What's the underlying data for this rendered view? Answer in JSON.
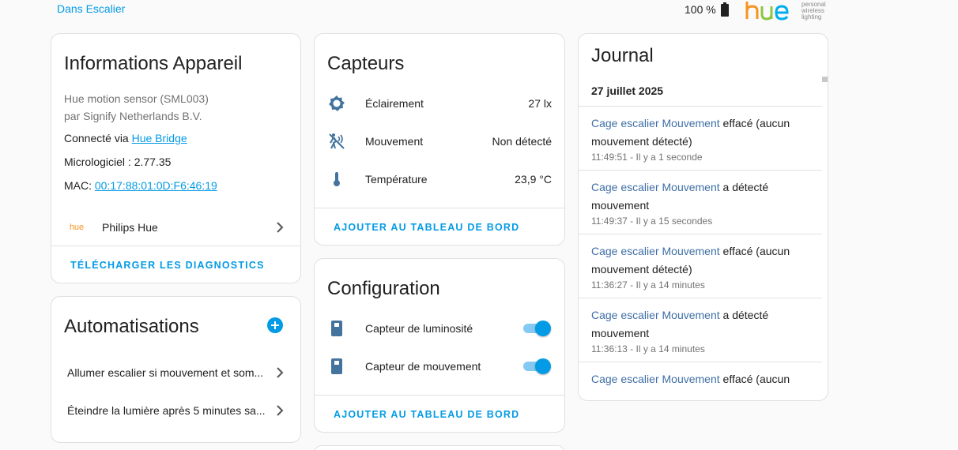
{
  "header": {
    "area_link": "Dans Escalier",
    "battery": "100 %",
    "logo": {
      "word": "hue",
      "tagline": [
        "personal",
        "wireless",
        "lighting"
      ]
    }
  },
  "device_info": {
    "title": "Informations Appareil",
    "model": "Hue motion sensor (SML003)",
    "manufacturer": "par Signify Netherlands B.V.",
    "connected_prefix": "Connecté via ",
    "connected_link": "Hue Bridge",
    "firmware": "Micrologiciel : 2.77.35",
    "mac_prefix": "MAC: ",
    "mac_value": "00:17:88:01:0D:F6:46:19",
    "integration_logo": "hue",
    "integration_name": "Philips Hue",
    "download_button": "Télécharger les diagnostics"
  },
  "automations": {
    "title": "Automatisations",
    "items": [
      {
        "label": "Allumer escalier si mouvement et som..."
      },
      {
        "label": "Éteindre la lumière après 5 minutes sa..."
      }
    ]
  },
  "sensors": {
    "title": "Capteurs",
    "items": [
      {
        "icon": "brightness-icon",
        "label": "Éclairement",
        "value": "27 lx"
      },
      {
        "icon": "motion-off-icon",
        "label": "Mouvement",
        "value": "Non détecté"
      },
      {
        "icon": "thermometer-icon",
        "label": "Température",
        "value": "23,9 °C"
      }
    ],
    "add_button": "Ajouter au tableau de bord"
  },
  "configuration": {
    "title": "Configuration",
    "items": [
      {
        "icon": "sensor-icon",
        "label": "Capteur de luminosité",
        "on": true
      },
      {
        "icon": "sensor-icon",
        "label": "Capteur de mouvement",
        "on": true
      }
    ],
    "add_button": "Ajouter au tableau de bord"
  },
  "journal": {
    "title": "Journal",
    "date": "27 juillet 2025",
    "entries": [
      {
        "entity": "Cage escalier Mouvement",
        "action": " effacé (aucun mouvement détecté)",
        "time": "11:49:51 - Il y a 1 seconde"
      },
      {
        "entity": "Cage escalier Mouvement",
        "action": " a détecté mouvement",
        "time": "11:49:37 - Il y a 15 secondes"
      },
      {
        "entity": "Cage escalier Mouvement",
        "action": " effacé (aucun mouvement détecté)",
        "time": "11:36:27 - Il y a 14 minutes"
      },
      {
        "entity": "Cage escalier Mouvement",
        "action": " a détecté mouvement",
        "time": "11:36:13 - Il y a 14 minutes"
      },
      {
        "entity": "Cage escalier Mouvement",
        "action": " effacé (aucun mouvement détecté)",
        "time": ""
      }
    ]
  },
  "colors": {
    "accent": "#039be5",
    "icon": "#44739e",
    "entity_link": "#3f6fa5"
  }
}
